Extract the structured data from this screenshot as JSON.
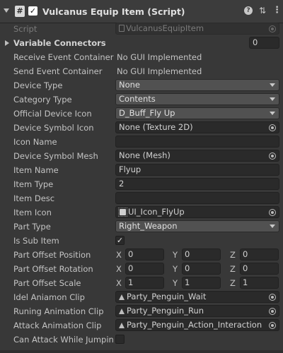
{
  "header": {
    "title": "Vulcanus Equip Item (Script)",
    "script_icon_glyph": "#",
    "enabled_check": "✓",
    "help_glyph": "?",
    "preset_glyph": "⇅",
    "menu_glyph": "⋮"
  },
  "rows": {
    "script": {
      "label": "Script",
      "value": "VulcanusEquipItem"
    },
    "variable_connectors": {
      "label": "Variable Connectors",
      "count": "0"
    },
    "receive_event": {
      "label": "Receive Event Container",
      "value": "No GUI Implemented"
    },
    "send_event": {
      "label": "Send Event Container",
      "value": "No GUI Implemented"
    },
    "device_type": {
      "label": "Device Type",
      "value": "None"
    },
    "category_type": {
      "label": "Category Type",
      "value": "Contents"
    },
    "official_device_icon": {
      "label": "Official Device Icon",
      "value": "D_Buff_Fly Up"
    },
    "device_symbol_icon": {
      "label": "Device Symbol Icon",
      "value": "None (Texture 2D)"
    },
    "icon_name": {
      "label": "Icon Name",
      "value": ""
    },
    "device_symbol_mesh": {
      "label": "Device Symbol Mesh",
      "value": "None (Mesh)"
    },
    "item_name": {
      "label": "Item Name",
      "value": "Flyup"
    },
    "item_type": {
      "label": "Item Type",
      "value": "2"
    },
    "item_desc": {
      "label": "Item Desc",
      "value": ""
    },
    "item_icon": {
      "label": "Item Icon",
      "value": "UI_Icon_FlyUp"
    },
    "part_type": {
      "label": "Part Type",
      "value": "Right_Weapon"
    },
    "is_sub_item": {
      "label": "Is Sub Item",
      "checked": "✓"
    },
    "part_offset_position": {
      "label": "Part Offset Position",
      "x": "0",
      "y": "0",
      "z": "0"
    },
    "part_offset_rotation": {
      "label": "Part Offset Rotation",
      "x": "0",
      "y": "0",
      "z": "0"
    },
    "part_offset_scale": {
      "label": "Part Offset Scale",
      "x": "1",
      "y": "1",
      "z": "1"
    },
    "idle_clip": {
      "label": "Idel Aniamon Clip",
      "value": "Party_Penguin_Wait"
    },
    "run_clip": {
      "label": "Runing Animation Clip",
      "value": "Party_Penguin_Run"
    },
    "attack_clip": {
      "label": "Attack Animation Clip",
      "value": "Party_Penguin_Action_Interaction"
    },
    "can_attack_jumping": {
      "label": "Can Attack While Jumpin",
      "checked": ""
    }
  },
  "axis_labels": {
    "x": "X",
    "y": "Y",
    "z": "Z"
  }
}
